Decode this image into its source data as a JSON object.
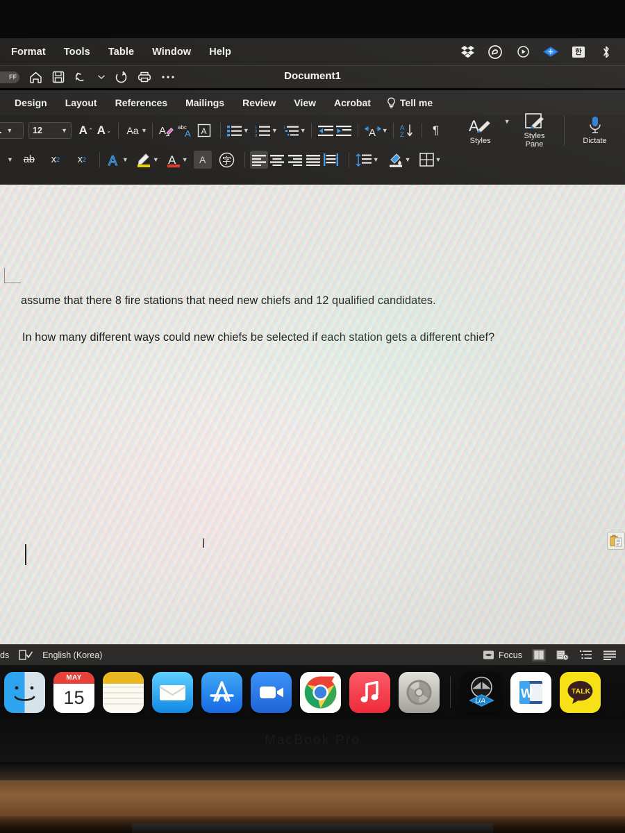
{
  "menubar": {
    "items": [
      "Format",
      "Tools",
      "Table",
      "Window",
      "Help"
    ],
    "tray": [
      {
        "name": "dropbox-icon",
        "label": "Dropbox"
      },
      {
        "name": "adobe-creative-cloud-icon",
        "label": "Creative Cloud"
      },
      {
        "name": "media-play-icon",
        "label": "Media"
      },
      {
        "name": "input-source-diamond-icon",
        "label": "Input Source"
      },
      {
        "name": "korean-input-icon",
        "label": "한"
      },
      {
        "name": "bluetooth-icon",
        "label": "Bluetooth"
      }
    ]
  },
  "quick_access": {
    "autosave_label": "FF",
    "buttons": [
      {
        "name": "home-icon",
        "label": "Home"
      },
      {
        "name": "save-icon",
        "label": "Save"
      },
      {
        "name": "undo-icon",
        "label": "Undo"
      },
      {
        "name": "undo-dropdown-icon",
        "label": "Undo options"
      },
      {
        "name": "redo-icon",
        "label": "Redo"
      },
      {
        "name": "print-icon",
        "label": "Print"
      },
      {
        "name": "more-options-icon",
        "label": "More"
      }
    ]
  },
  "window": {
    "title": "Document1"
  },
  "ribbon": {
    "tabs": [
      "Design",
      "Layout",
      "References",
      "Mailings",
      "Review",
      "View",
      "Acrobat"
    ],
    "tell_me": "Tell me",
    "font": {
      "font_name": "...",
      "font_size": "12",
      "grow_font": "A",
      "shrink_font": "A",
      "change_case": "Aa",
      "clear_formatting": "Clear Formatting",
      "spelling_label": "abc",
      "character_border": "A",
      "strikethrough": "ab",
      "subscript": "x",
      "subscript_sub": "2",
      "superscript": "x",
      "superscript_sup": "2",
      "text_effects": "A",
      "highlight": "Highlight",
      "font_color": "A",
      "character_shading": "A",
      "phonetic_guide": "字"
    },
    "paragraph": {
      "bullets": "Bullets",
      "numbering": "Numbering",
      "multilevel": "Multilevel List",
      "decrease_indent": "Decrease Indent",
      "increase_indent": "Increase Indent",
      "character_spacing": "Character Spacing",
      "sort": "Sort",
      "show_marks": "¶",
      "align_left": "Align Left",
      "align_center": "Center",
      "align_right": "Align Right",
      "justify": "Justify",
      "distributed": "Distributed",
      "line_spacing": "Line Spacing",
      "shading": "Shading",
      "borders": "Borders"
    },
    "styles": {
      "styles_label": "Styles",
      "styles_pane_label": "Styles\nPane",
      "styles_pane_line1": "Styles",
      "styles_pane_line2": "Pane",
      "dictate_label": "Dictate"
    }
  },
  "document": {
    "line1": "assume that there 8 fire stations that need new chiefs and 12 qualified candidates.",
    "line2": "In how many different ways could new chiefs be selected if each station gets a different chief?"
  },
  "statusbar": {
    "words_label": "ds",
    "proofing_icon": "proofing-icon",
    "language": "English (Korea)",
    "focus_label": "Focus",
    "views": [
      "print-layout-view-icon",
      "web-layout-view-icon",
      "outline-view-icon",
      "draft-view-icon"
    ]
  },
  "dock": {
    "apps": [
      {
        "name": "finder-icon",
        "label": "Finder"
      },
      {
        "name": "calendar-icon",
        "label": "Calendar",
        "month": "MAY",
        "day": "15"
      },
      {
        "name": "notes-icon",
        "label": "Notes"
      },
      {
        "name": "mail-icon",
        "label": "Mail"
      },
      {
        "name": "app-store-icon",
        "label": "App Store"
      },
      {
        "name": "zoom-icon",
        "label": "Zoom"
      },
      {
        "name": "chrome-icon",
        "label": "Google Chrome"
      },
      {
        "name": "music-icon",
        "label": "Music"
      },
      {
        "name": "system-preferences-icon",
        "label": "System Preferences"
      },
      {
        "name": "universal-audio-icon",
        "label": "UA"
      },
      {
        "name": "microsoft-word-icon",
        "label": "W"
      },
      {
        "name": "kakaotalk-icon",
        "label": "TALK"
      }
    ]
  },
  "laptop": {
    "brand": "MacBook Pro"
  },
  "colors": {
    "menubar_bg": "#232220",
    "ribbon_bg": "#262523",
    "accent_blue": "#2f9cf4",
    "highlight_yellow": "#e9d200",
    "font_color_red": "#e03a2a",
    "page_bg": "#eceae6"
  }
}
